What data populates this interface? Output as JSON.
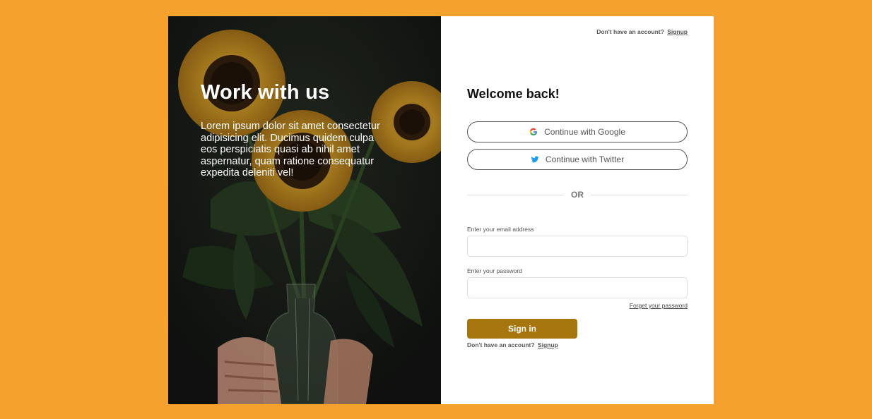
{
  "hero": {
    "title": "Work with us",
    "text": "Lorem ipsum dolor sit amet consectetur adipisicing elit. Ducimus quidem culpa eos perspiciatis quasi ab nihil amet aspernatur, quam ratione consequatur expedita deleniti vel!",
    "image_icon": "sunflower-bouquet-photo"
  },
  "header": {
    "prompt": "Don't have an account?",
    "link": "Signup"
  },
  "form": {
    "title": "Welcome back!",
    "google_label": "Continue with Google",
    "twitter_label": "Continue with Twitter",
    "divider_text": "OR",
    "email_label": "Enter your email address",
    "email_value": "",
    "email_placeholder": "",
    "password_label": "Enter your password",
    "password_value": "",
    "password_placeholder": "",
    "forgot_label": "Forget your password",
    "signin_label": "Sign in",
    "bottom_prompt": "Don't have an account?",
    "bottom_link": "Signup"
  },
  "icons": {
    "google": "google-icon",
    "twitter": "twitter-icon"
  },
  "colors": {
    "background": "#f5a12e",
    "accent": "#a6750d",
    "twitter": "#1d9bf0"
  }
}
